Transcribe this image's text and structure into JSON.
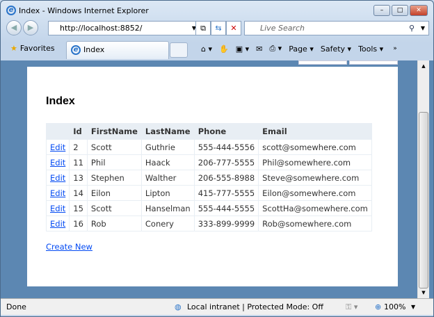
{
  "window": {
    "title": "Index - Windows Internet Explorer"
  },
  "address": {
    "url": "http://localhost:8852/"
  },
  "search": {
    "placeholder": "Live Search"
  },
  "toolbar": {
    "favorites": "Favorites",
    "tab_title": "Index",
    "page": "Page ▾",
    "safety": "Safety ▾",
    "tools": "Tools ▾"
  },
  "main": {
    "heading": "Index",
    "columns": [
      "",
      "Id",
      "FirstName",
      "LastName",
      "Phone",
      "Email"
    ],
    "rows": [
      {
        "action": "Edit",
        "id": "2",
        "first": "Scott",
        "last": "Guthrie",
        "phone": "555-444-5556",
        "email": "scott@somewhere.com"
      },
      {
        "action": "Edit",
        "id": "11",
        "first": "Phil",
        "last": "Haack",
        "phone": "206-777-5555",
        "email": "Phil@somewhere.com"
      },
      {
        "action": "Edit",
        "id": "13",
        "first": "Stephen",
        "last": "Walther",
        "phone": "206-555-8988",
        "email": "Steve@somewhere.com"
      },
      {
        "action": "Edit",
        "id": "14",
        "first": "Eilon",
        "last": "Lipton",
        "phone": "415-777-5555",
        "email": "Eilon@somewhere.com"
      },
      {
        "action": "Edit",
        "id": "15",
        "first": "Scott",
        "last": "Hanselman",
        "phone": "555-444-5555",
        "email": "ScottHa@somewhere.com"
      },
      {
        "action": "Edit",
        "id": "16",
        "first": "Rob",
        "last": "Conery",
        "phone": "333-899-9999",
        "email": "Rob@somewhere.com"
      }
    ],
    "create_new": "Create New"
  },
  "status": {
    "text": "Done",
    "zone": "Local intranet | Protected Mode: Off",
    "zoom": "100%"
  }
}
